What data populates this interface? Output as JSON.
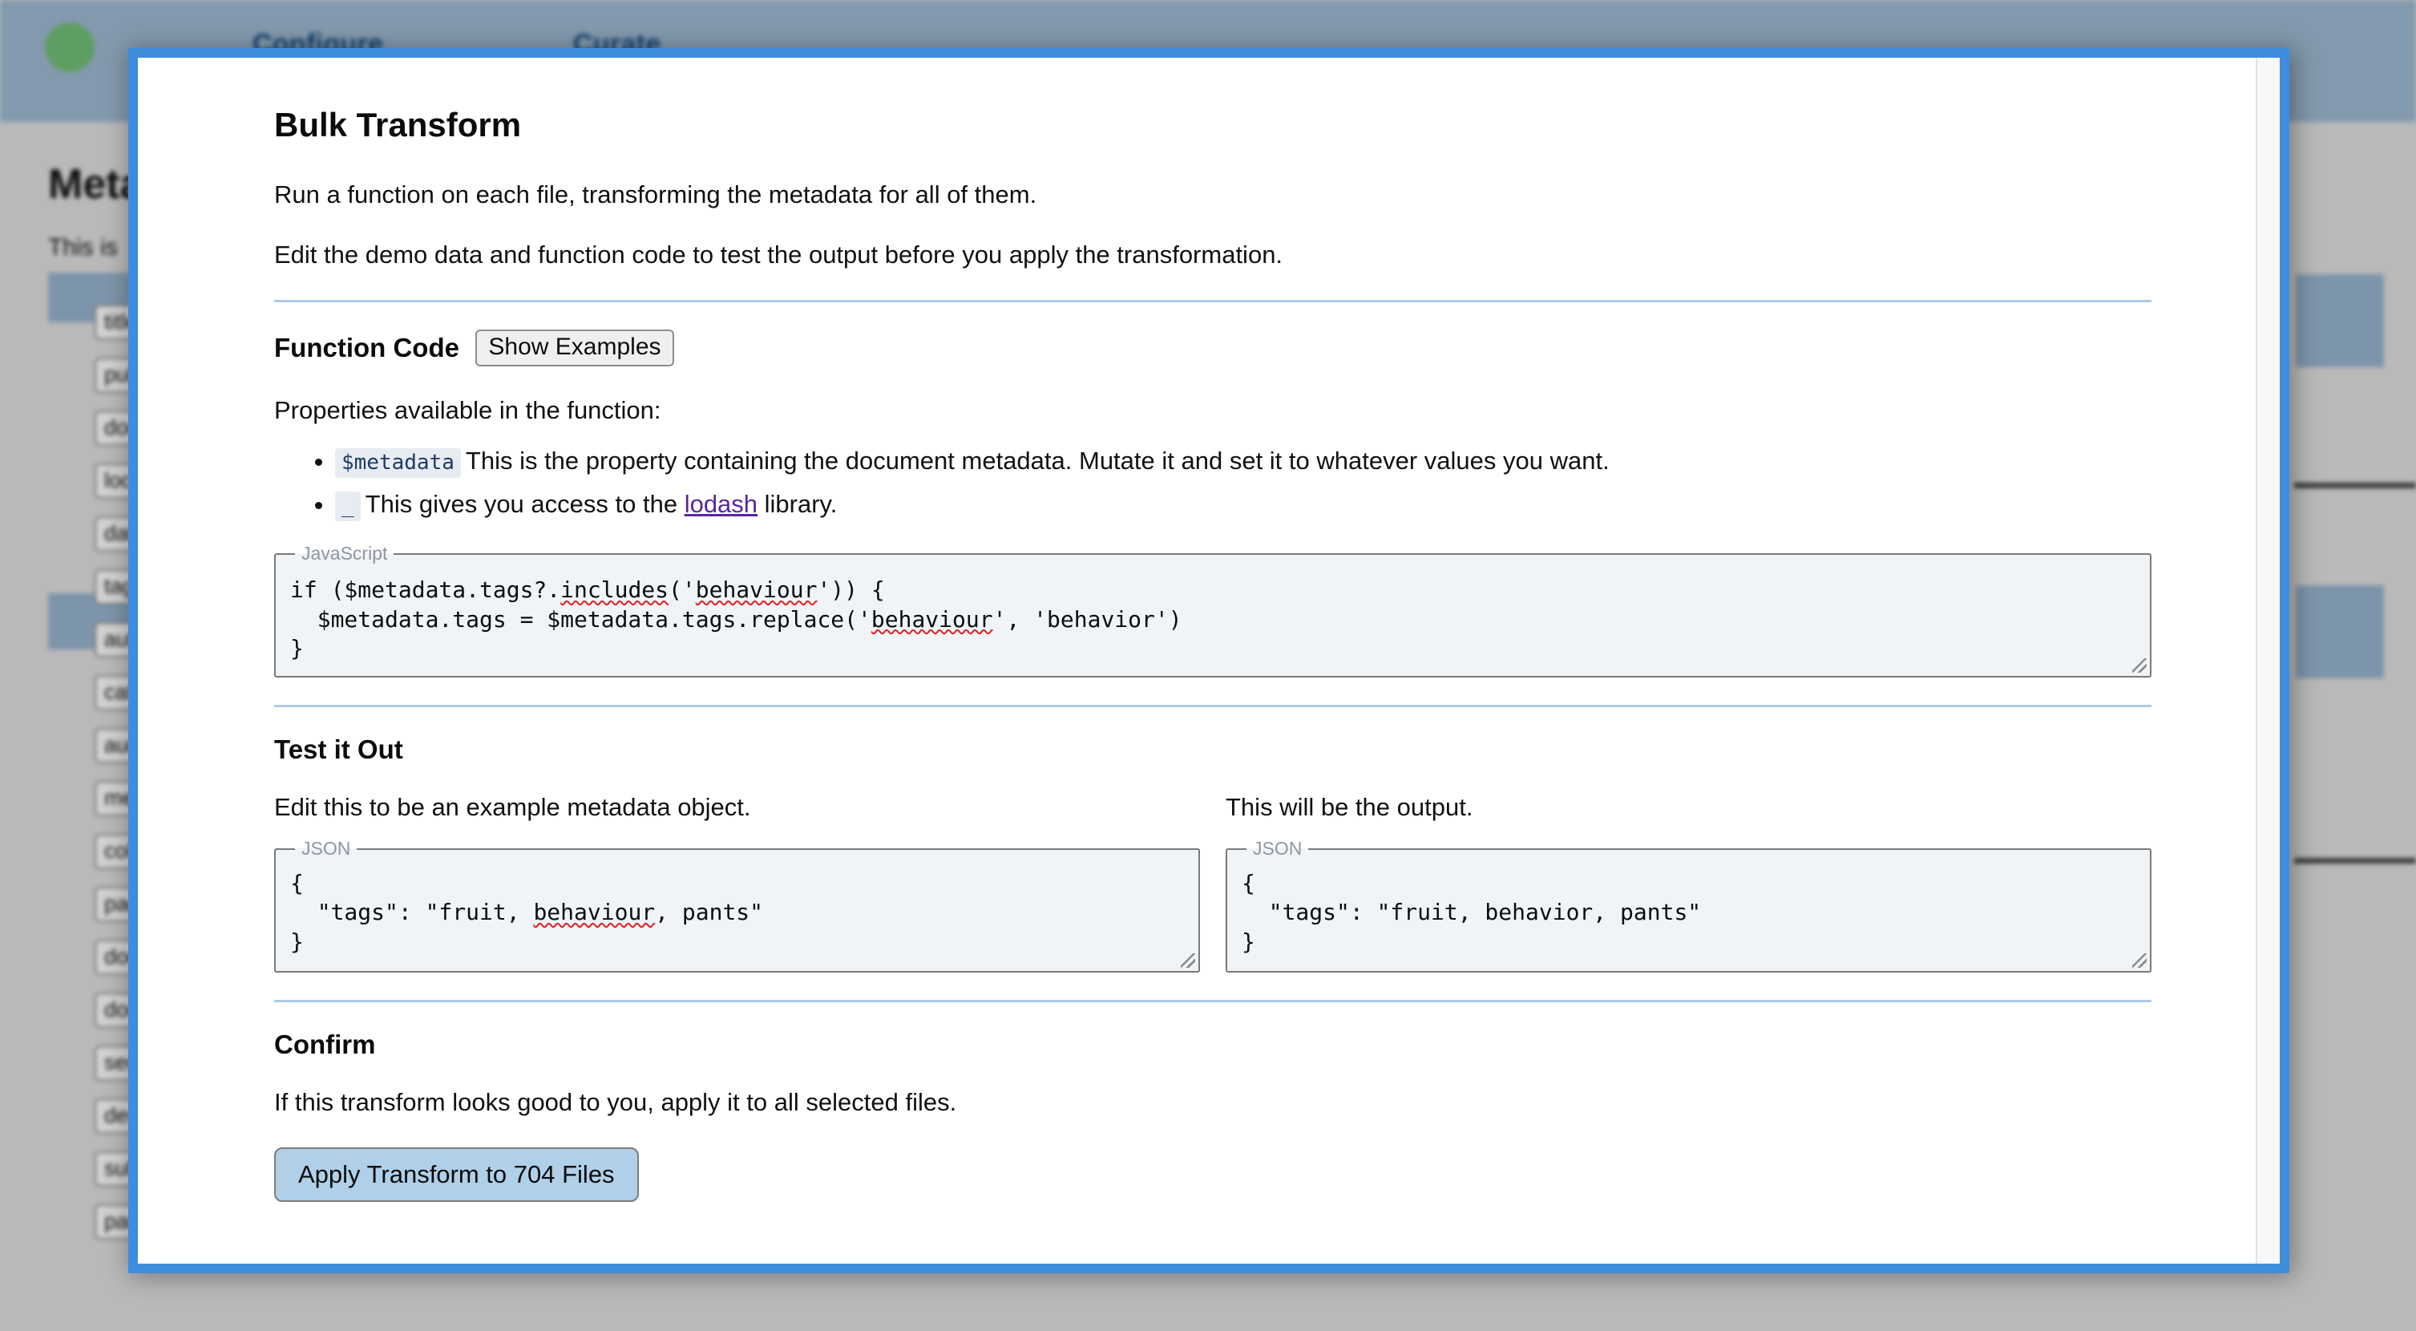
{
  "background": {
    "nav": [
      {
        "label": "Configure"
      },
      {
        "label": "Curate"
      }
    ],
    "page_title": "Metadata",
    "page_subtitle": "This is ",
    "field_chips": [
      {
        "label": "title"
      },
      {
        "label": "publisher"
      },
      {
        "label": "document"
      },
      {
        "label": "location"
      },
      {
        "label": "date"
      },
      {
        "label": "tags"
      },
      {
        "label": "author"
      },
      {
        "label": "category"
      },
      {
        "label": "audience"
      },
      {
        "label": "medium"
      },
      {
        "label": "collection"
      },
      {
        "label": "page"
      },
      {
        "label": "document_type"
      },
      {
        "label": "doc_id"
      },
      {
        "label": "series"
      },
      {
        "label": "description"
      },
      {
        "label": "subject"
      },
      {
        "label": "participants"
      }
    ]
  },
  "modal": {
    "title": "Bulk Transform",
    "intro_1": "Run a function on each file, transforming the metadata for all of them.",
    "intro_2": "Edit the demo data and function code to test the output before you apply the transformation.",
    "function_code": {
      "heading": "Function Code",
      "show_examples_label": "Show Examples",
      "properties_label": "Properties available in the function:",
      "properties": [
        {
          "code": "$metadata",
          "text_before_link": "This is the property containing the document metadata. Mutate it and set it to whatever values you want.",
          "link": "",
          "text_after_link": ""
        },
        {
          "code": "_",
          "text_before_link": "This gives you access to the ",
          "link": "lodash",
          "text_after_link": " library."
        }
      ],
      "editor_legend": "JavaScript",
      "editor_line_1_a": "if ($metadata.tags?.",
      "editor_line_1_b": "includes",
      "editor_line_1_c": "('",
      "editor_line_1_d": "behaviour",
      "editor_line_1_e": "')) {",
      "editor_line_2_a": "  $metadata.tags = $metadata.tags.replace('",
      "editor_line_2_b": "behaviour",
      "editor_line_2_c": "', 'behavior')",
      "editor_line_3": "}"
    },
    "test_it_out": {
      "heading": "Test it Out",
      "input_label": "Edit this to be an example metadata object.",
      "output_label": "This will be the output.",
      "input_legend": "JSON",
      "output_legend": "JSON",
      "input_line_1": "{",
      "input_line_2_a": "  \"tags\": \"fruit, ",
      "input_line_2_b": "behaviour",
      "input_line_2_c": ", pants\"",
      "input_line_3": "}",
      "output_line_1": "{",
      "output_line_2": "  \"tags\": \"fruit, behavior, pants\"",
      "output_line_3": "}"
    },
    "confirm": {
      "heading": "Confirm",
      "text": "If this transform looks good to you, apply it to all selected files.",
      "apply_label": "Apply Transform to 704 Files"
    }
  },
  "colors": {
    "modal_border": "#3e8ddd",
    "topbar": "#8399ad",
    "avatar": "#5e9e62",
    "accent_rule": "#aacbe8",
    "primary_button": "#afd0e8",
    "link": "#59269e"
  }
}
